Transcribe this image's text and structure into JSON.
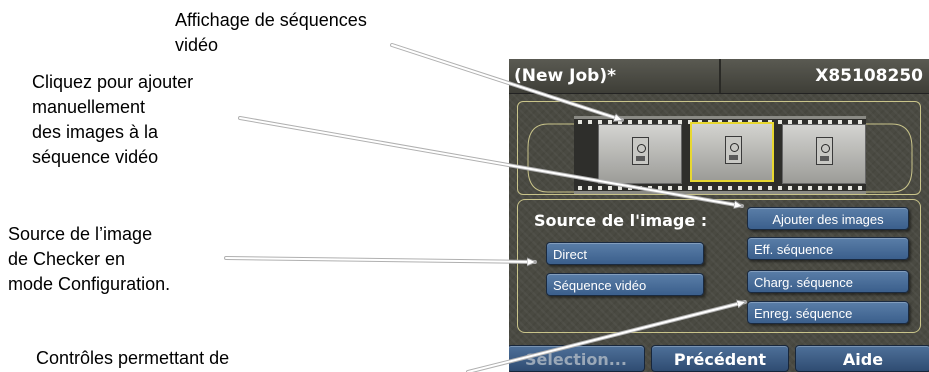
{
  "callouts": {
    "filmstrip": [
      "Affichage de séquences",
      "vidéo"
    ],
    "add_images": [
      "Cliquez pour ajouter",
      "manuellement",
      "des images à la",
      "séquence vidéo"
    ],
    "image_source": [
      "Source de l’image",
      "de Checker en",
      "mode Configuration."
    ],
    "controls": [
      "Contrôles permettant de"
    ]
  },
  "app": {
    "job_title": "(New Job)*",
    "device_id": "X85108250"
  },
  "filmstrip": {
    "frames": 3,
    "selected_index": 1
  },
  "source": {
    "label": "Source de l'image :",
    "options": [
      "Direct",
      "Séquence vidéo"
    ]
  },
  "sequence_buttons": {
    "add_images": "Ajouter des images",
    "clear": "Eff. séquence",
    "load": "Charg. séquence",
    "save": "Enreg. séquence"
  },
  "bottom_buttons": {
    "selection": "Sélection...",
    "previous": "Précédent",
    "help": "Aide"
  },
  "colors": {
    "panel_bg": "#4a4a42",
    "button_blue": "#4a6f9a",
    "frame_outline": "#c9c48a",
    "selected_frame": "#e8d830"
  }
}
